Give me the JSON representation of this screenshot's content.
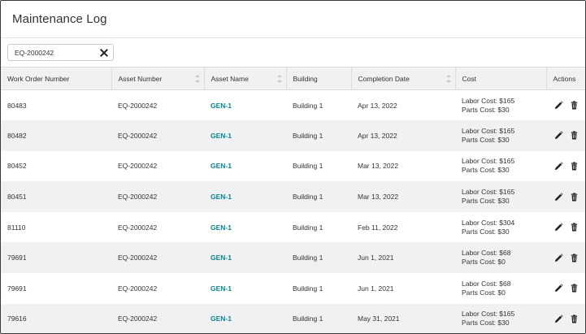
{
  "page": {
    "title": "Maintenance Log"
  },
  "filter": {
    "value": "EQ-2000242"
  },
  "columns": [
    "Work Order Number",
    "Asset Number",
    "Asset Name",
    "Building",
    "Completion Date",
    "Cost",
    "Actions"
  ],
  "rows": [
    {
      "wo": "80483",
      "asset_number": "EQ-2000242",
      "asset_name": "GEN-1",
      "building": "Building 1",
      "date": "Apr 13, 2022",
      "labor": "Labor Cost: $165",
      "parts": "Parts Cost: $30"
    },
    {
      "wo": "80482",
      "asset_number": "EQ-2000242",
      "asset_name": "GEN-1",
      "building": "Building 1",
      "date": "Apr 13, 2022",
      "labor": "Labor Cost: $165",
      "parts": "Parts Cost: $30"
    },
    {
      "wo": "80452",
      "asset_number": "EQ-2000242",
      "asset_name": "GEN-1",
      "building": "Building 1",
      "date": "Mar 13, 2022",
      "labor": "Labor Cost: $165",
      "parts": "Parts Cost: $30"
    },
    {
      "wo": "80451",
      "asset_number": "EQ-2000242",
      "asset_name": "GEN-1",
      "building": "Building 1",
      "date": "Mar 13, 2022",
      "labor": "Labor Cost: $165",
      "parts": "Parts Cost: $30"
    },
    {
      "wo": "81110",
      "asset_number": "EQ-2000242",
      "asset_name": "GEN-1",
      "building": "Building 1",
      "date": "Feb 11, 2022",
      "labor": "Labor Cost: $304",
      "parts": "Parts Cost: $30"
    },
    {
      "wo": "79691",
      "asset_number": "EQ-2000242",
      "asset_name": "GEN-1",
      "building": "Building 1",
      "date": "Jun 1, 2021",
      "labor": "Labor Cost: $68",
      "parts": "Parts Cost: $0"
    },
    {
      "wo": "79691",
      "asset_number": "EQ-2000242",
      "asset_name": "GEN-1",
      "building": "Building 1",
      "date": "Jun 1, 2021",
      "labor": "Labor Cost: $68",
      "parts": "Parts Cost: $0"
    },
    {
      "wo": "79616",
      "asset_number": "EQ-2000242",
      "asset_name": "GEN-1",
      "building": "Building 1",
      "date": "May 31, 2021",
      "labor": "Labor Cost: $165",
      "parts": "Parts Cost: $30"
    }
  ],
  "icons": {
    "edit": "pencil-icon",
    "delete": "trash-icon",
    "clear": "close-icon"
  },
  "colors": {
    "link": "#177e86",
    "header_bg": "#f0f1f2",
    "stripe": "#f0f1f2"
  }
}
